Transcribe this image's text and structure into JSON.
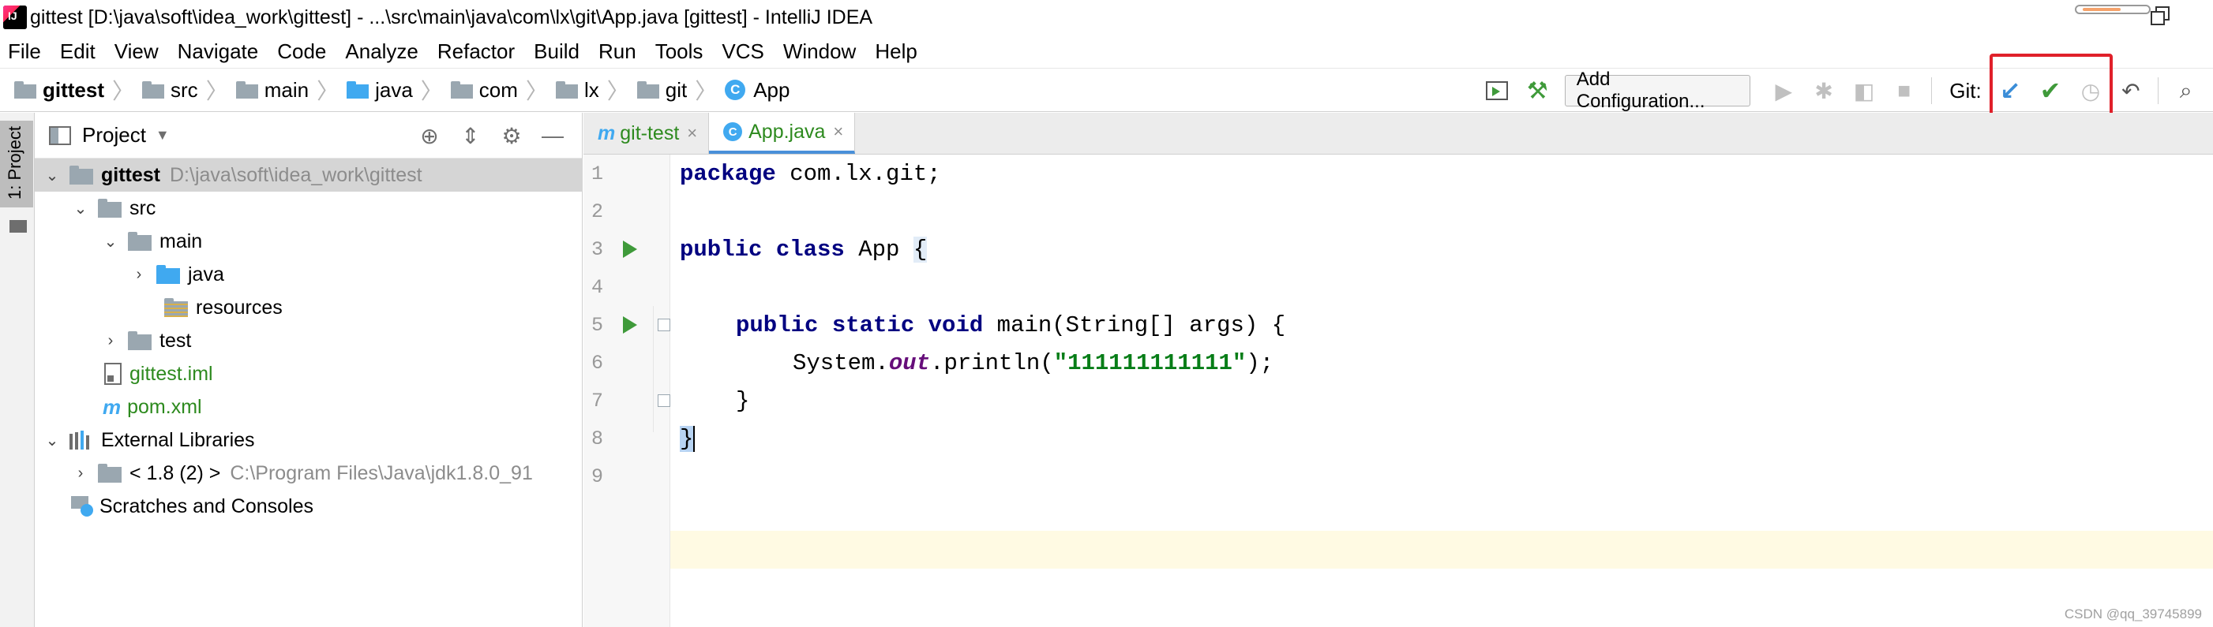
{
  "window": {
    "title": "gittest [D:\\java\\soft\\idea_work\\gittest] - ...\\src\\main\\java\\com\\lx\\git\\App.java [gittest] - IntelliJ IDEA"
  },
  "menu": [
    "File",
    "Edit",
    "View",
    "Navigate",
    "Code",
    "Analyze",
    "Refactor",
    "Build",
    "Run",
    "Tools",
    "VCS",
    "Window",
    "Help"
  ],
  "breadcrumb": [
    "gittest",
    "src",
    "main",
    "java",
    "com",
    "lx",
    "git",
    "App"
  ],
  "toolbar": {
    "add_config": "Add Configuration...",
    "git_label": "Git:"
  },
  "project_panel": {
    "title": "Project",
    "stripe_label": "1: Project",
    "tree": {
      "root_name": "gittest",
      "root_path": "D:\\java\\soft\\idea_work\\gittest",
      "src": "src",
      "main": "main",
      "java": "java",
      "resources": "resources",
      "test": "test",
      "iml": "gittest.iml",
      "pom": "pom.xml",
      "ext_libs": "External Libraries",
      "jdk": "< 1.8 (2) >",
      "jdk_path": "C:\\Program Files\\Java\\jdk1.8.0_91",
      "scratches": "Scratches and Consoles"
    }
  },
  "editor": {
    "tabs": [
      {
        "label": "git-test",
        "active": false
      },
      {
        "label": "App.java",
        "active": true
      }
    ],
    "line_numbers": [
      "1",
      "2",
      "3",
      "4",
      "5",
      "6",
      "7",
      "8",
      "9"
    ],
    "code": {
      "l1_kw": "package",
      "l1_rest": " com.lx.git;",
      "l3_kw": "public class",
      "l3_name": " App ",
      "l3_brace": "{",
      "l5_kw": "public static void",
      "l5_rest": " main(String[] args) {",
      "l6_pre": "System.",
      "l6_field": "out",
      "l6_mid": ".println(",
      "l6_str": "\"111111111111\"",
      "l6_end": ");",
      "l7": "}",
      "l8": "}"
    }
  },
  "watermark": "CSDN @qq_39745899",
  "colors": {
    "accent": "#40a9f0",
    "keyword": "#000080",
    "string": "#067d17",
    "highlight_box": "#e0202a",
    "current_line": "#fffae3"
  }
}
